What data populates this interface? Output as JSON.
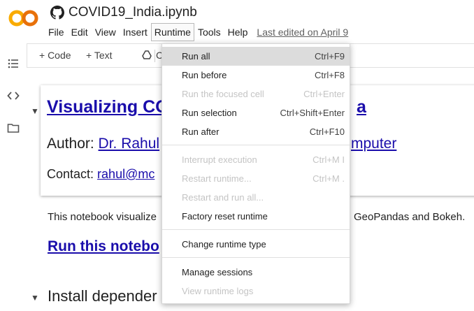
{
  "header": {
    "title": "COVID19_India.ipynb",
    "logo_text": "CO",
    "last_edited": "Last edited on April 9"
  },
  "menu": {
    "items": [
      "File",
      "Edit",
      "View",
      "Insert",
      "Runtime",
      "Tools",
      "Help"
    ],
    "active": "Runtime"
  },
  "toolbar": {
    "code_label": "+ Code",
    "text_label": "+ Text",
    "copy_label": "C"
  },
  "notebook": {
    "heading": "Visualizing CO",
    "heading_tail": "a",
    "author_prefix": "Author: ",
    "author_link": "Dr. Rahul",
    "author_tail": "mputer",
    "contact_prefix": "Contact: ",
    "contact_link": "rahul@mc",
    "description": "This notebook visualize",
    "description_tail": "GeoPandas and Bokeh.",
    "run_link": "Run this notebo",
    "install_heading": "Install depender"
  },
  "runtime_menu": {
    "items": [
      {
        "label": "Run all",
        "shortcut": "Ctrl+F9",
        "disabled": false,
        "highlighted": true
      },
      {
        "label": "Run before",
        "shortcut": "Ctrl+F8",
        "disabled": false
      },
      {
        "label": "Run the focused cell",
        "shortcut": "Ctrl+Enter",
        "disabled": true
      },
      {
        "label": "Run selection",
        "shortcut": "Ctrl+Shift+Enter",
        "disabled": false
      },
      {
        "label": "Run after",
        "shortcut": "Ctrl+F10",
        "disabled": false
      },
      {
        "label": "Interrupt execution",
        "shortcut": "Ctrl+M I",
        "disabled": true
      },
      {
        "label": "Restart runtime...",
        "shortcut": "Ctrl+M .",
        "disabled": true
      },
      {
        "label": "Restart and run all...",
        "shortcut": "",
        "disabled": true
      },
      {
        "label": "Factory reset runtime",
        "shortcut": "",
        "disabled": false
      },
      {
        "label": "Change runtime type",
        "shortcut": "",
        "disabled": false
      },
      {
        "label": "Manage sessions",
        "shortcut": "",
        "disabled": false
      },
      {
        "label": "View runtime logs",
        "shortcut": "",
        "disabled": true
      }
    ]
  },
  "colors": {
    "logo_orange": "#F9AB00",
    "logo_dark_orange": "#E8710A",
    "link_blue": "#1a0dab"
  }
}
